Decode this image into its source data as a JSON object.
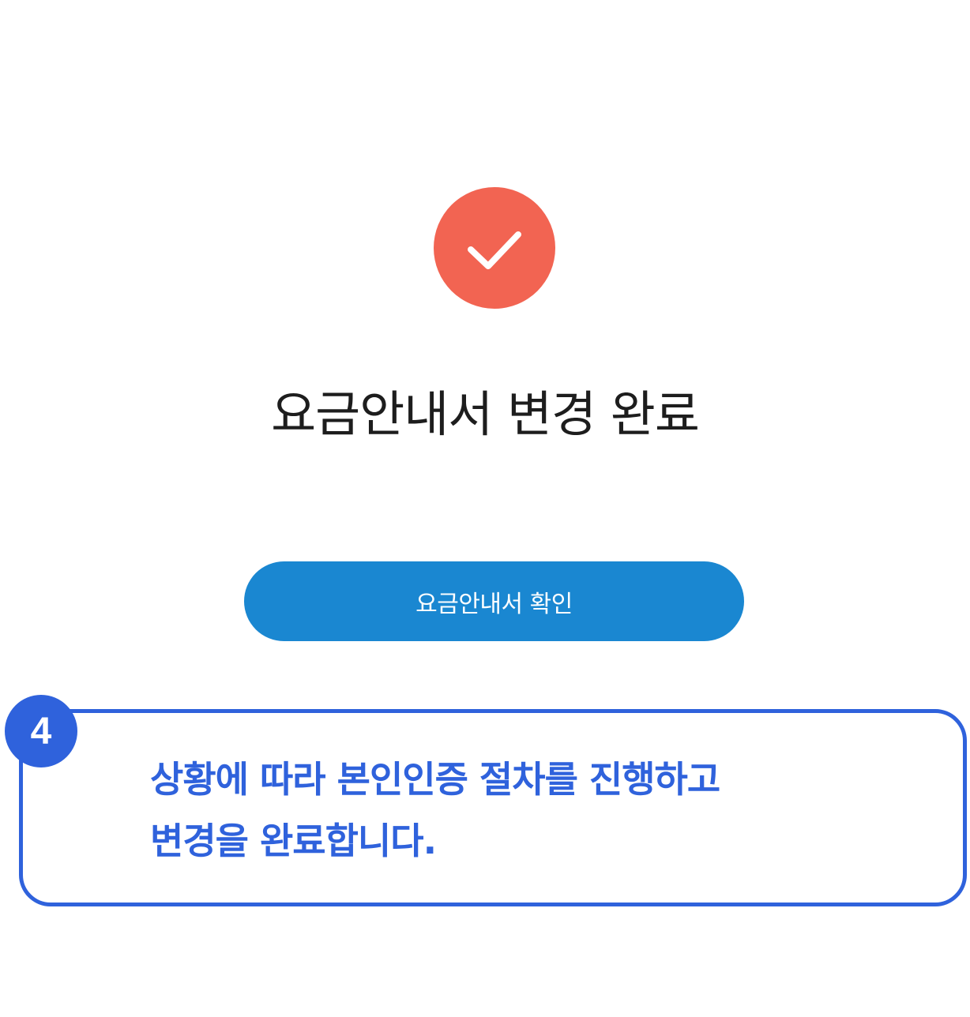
{
  "colors": {
    "success": "#f26452",
    "primary": "#1a87d1",
    "callout": "#2f62dc"
  },
  "icons": {
    "success": "check-icon"
  },
  "page": {
    "title": "요금안내서 변경 완료"
  },
  "actions": {
    "confirm_label": "요금안내서 확인"
  },
  "callout": {
    "step_number": "4",
    "line1": "상황에 따라 본인인증 절차를 진행하고",
    "line2": "변경을 완료합니다."
  }
}
